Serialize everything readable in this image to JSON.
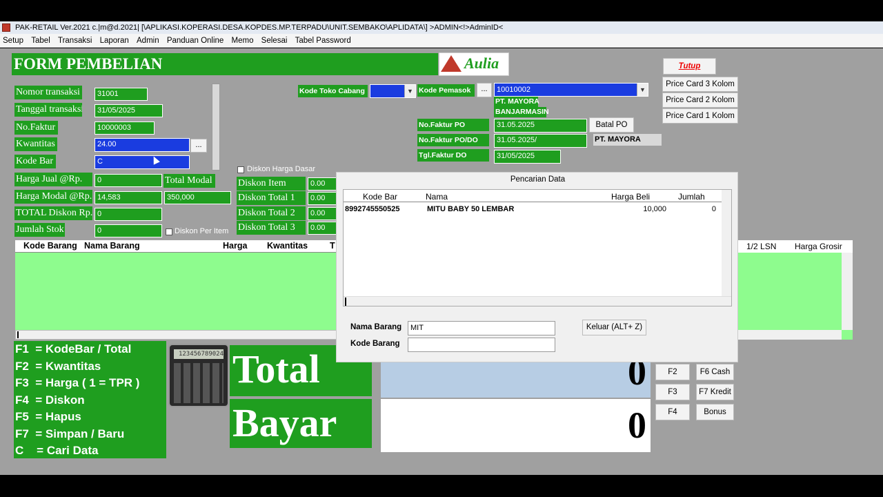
{
  "window": {
    "title": "PAK-RETAIL Ver.2021 c.|m@d.2021| [\\APLIKASI.KOPERASI.DESA.KOPDES.MP.TERPADU\\UNIT.SEMBAKO\\APLIDATA\\] >ADMIN<!>AdminID<"
  },
  "menu": [
    "Setup",
    "Tabel",
    "Transaksi",
    "Laporan",
    "Admin",
    "Panduan Online",
    "Memo",
    "Selesai",
    "Tabel Password"
  ],
  "form": {
    "title": "FORM PEMBELIAN",
    "logo_text": "Aulia",
    "labels": {
      "nomor": "Nomor transaksi",
      "tanggal": "Tanggal transaksi",
      "faktur": "No.Faktur",
      "kwantitas": "Kwantitas",
      "kodebar": "Kode Bar",
      "harga_jual": "Harga Jual  @Rp.",
      "harga_modal": "Harga Modal @Rp.",
      "total_diskon": "TOTAL Diskon Rp.",
      "jumlah_stok": "Jumlah Stok",
      "total_modal": "Total Modal",
      "diskon_item": "Diskon Item",
      "diskon_total_1": "Diskon Total 1",
      "diskon_total_2": "Diskon Total 2",
      "diskon_total_3": "Diskon Total 3",
      "kode_toko": "Kode Toko Cabang",
      "kode_pemasok": "Kode Pemasok",
      "faktur_po": "No.Faktur PO",
      "faktur_podo": "No.Faktur PO/DO",
      "tgl_faktur_do": "Tgl.Faktur DO"
    },
    "values": {
      "nomor": "31001",
      "tanggal": "31/05/2025",
      "faktur": "10000003",
      "kwantitas": "24.00",
      "kodebar": "C",
      "harga_jual": "0",
      "harga_modal": "14,583",
      "total_diskon": "0",
      "jumlah_stok": "0",
      "total_modal": "350,000",
      "diskon_item": "0.00",
      "diskon_total_1": "0.00",
      "diskon_total_2": "0.00",
      "diskon_total_3": "0.00",
      "kode_pemasok": "10010002",
      "pemasok_nama": "PT. MAYORA",
      "pemasok_kota": "BANJARMASIN",
      "faktur_po": "31.05.2025",
      "faktur_podo": "31.05.2025/",
      "tgl_faktur_do": "31/05/2025",
      "pemasok_badge": "PT. MAYORA"
    },
    "checkboxes": {
      "diskon_harga_dasar": "Diskon Harga Dasar",
      "diskon_per_item": "Diskon Per Item"
    },
    "dots": "..."
  },
  "buttons": {
    "tutup": "Tutup",
    "price3": "Price Card 3 Kolom",
    "price2": "Price Card 2 Kolom",
    "price1": "Price Card 1 Kolom",
    "batal_po": "Batal PO",
    "f2": "F2",
    "f3": "F3",
    "f4": "F4",
    "f6": "F6 Cash",
    "f7": "F7 Kredit",
    "bonus": "Bonus"
  },
  "table": {
    "headers": [
      "Kode Barang",
      "Nama Barang",
      "Harga",
      "Kwantitas",
      "T"
    ],
    "right_headers": [
      "1/2 LSN",
      "Harga Grosir"
    ]
  },
  "keys": [
    "F1  = KodeBar / Total",
    "F2  = Kwantitas",
    "F3  = Harga ( 1 = TPR )",
    "F4  = Diskon",
    "F5  = Hapus",
    "F7  = Simpan / Baru",
    "C    = Cari Data"
  ],
  "calculator": {
    "display": "123456789024"
  },
  "totals": {
    "total_label": "Total",
    "bayar_label": "Bayar",
    "total_value": "0",
    "bayar_value": "0"
  },
  "dialog": {
    "title": "Pencarian Data",
    "headers": [
      "Kode Bar",
      "Nama",
      "Harga Beli",
      "Jumlah"
    ],
    "rows": [
      {
        "kode": "8992745550525",
        "nama": "MITU BABY  50 LEMBAR",
        "harga": "10,000",
        "jumlah": "0"
      }
    ],
    "nama_label": "Nama Barang",
    "nama_value": "MIT",
    "kode_label": "Kode Barang",
    "kode_value": "",
    "keluar": "Keluar (ALT+ Z)"
  }
}
